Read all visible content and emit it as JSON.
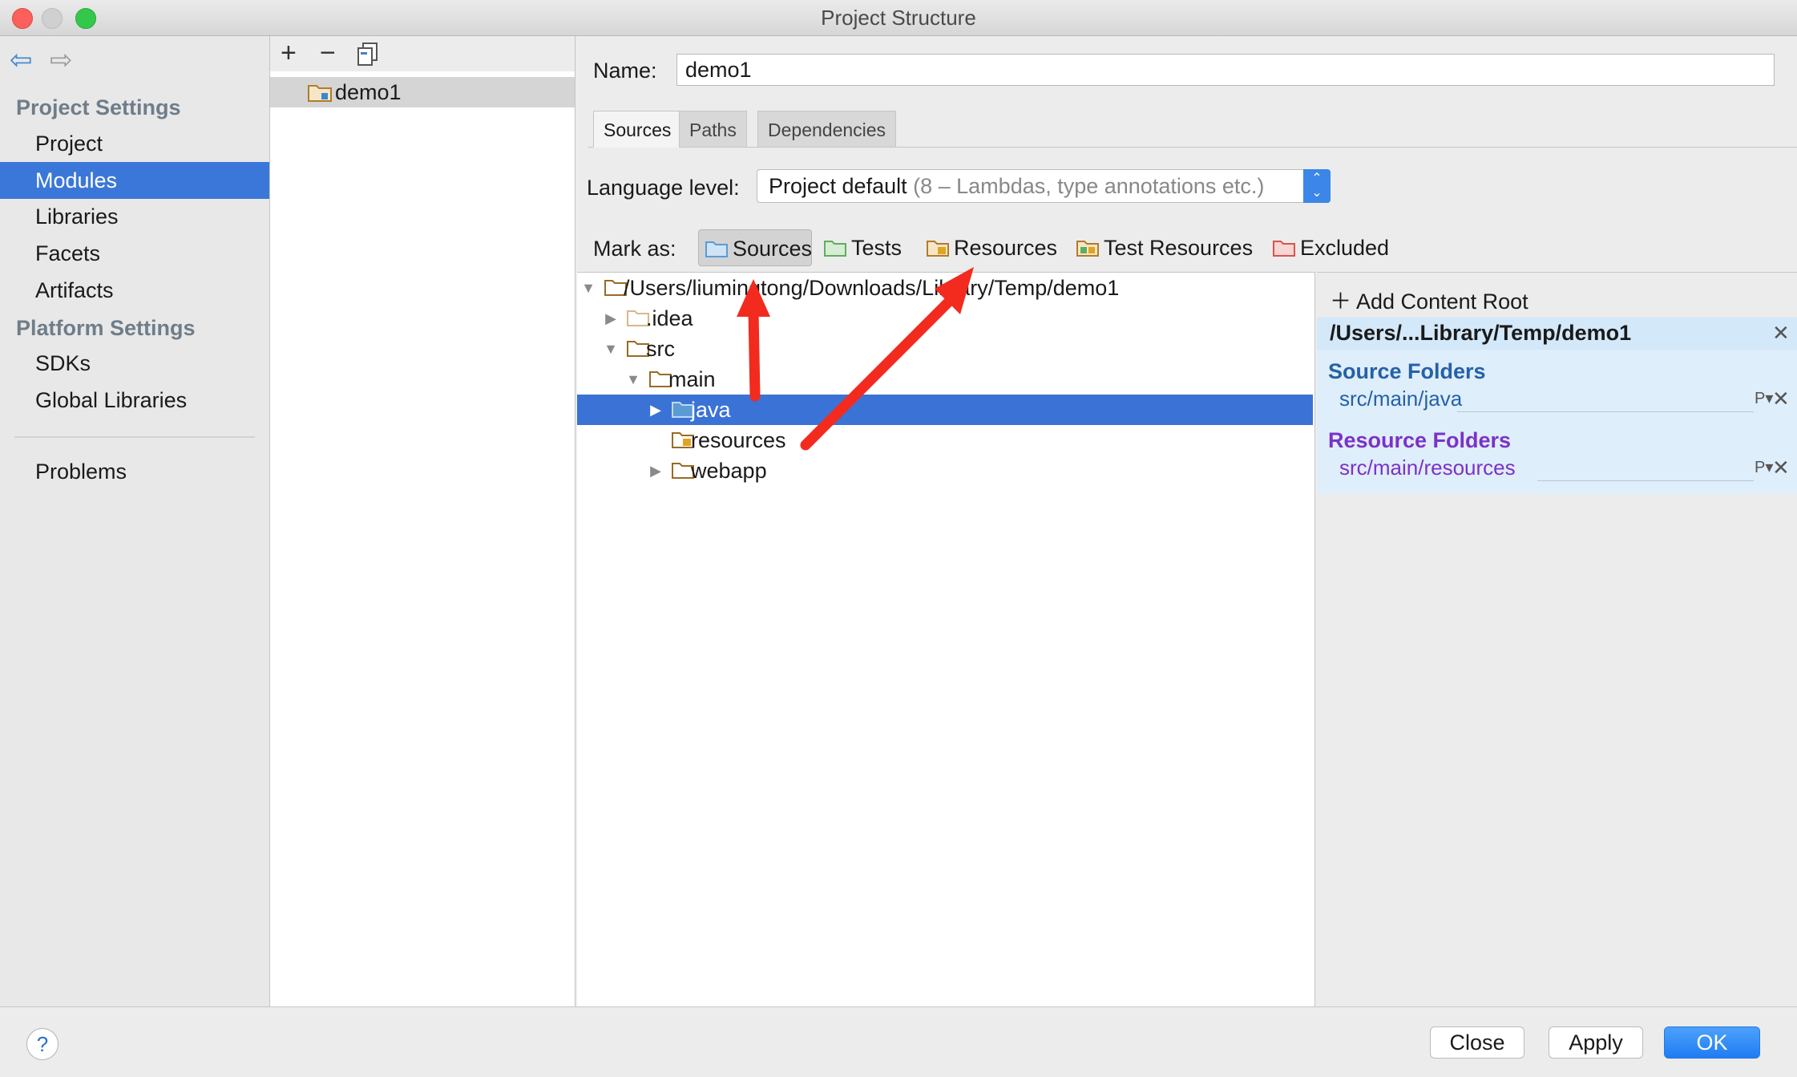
{
  "window": {
    "title": "Project Structure"
  },
  "sidebar": {
    "section_project": "Project Settings",
    "items_project": [
      "Project",
      "Modules",
      "Libraries",
      "Facets",
      "Artifacts"
    ],
    "section_platform": "Platform Settings",
    "items_platform": [
      "SDKs",
      "Global Libraries"
    ],
    "problems": "Problems",
    "selected": "Modules"
  },
  "modules": {
    "toolbar": {
      "add": "+",
      "remove": "−"
    },
    "items": [
      "demo1"
    ]
  },
  "content": {
    "name_label": "Name:",
    "name_value": "demo1",
    "tabs": [
      "Sources",
      "Paths",
      "Dependencies"
    ],
    "active_tab": "Sources",
    "language_label": "Language level:",
    "language_value": "Project default",
    "language_hint": "(8 – Lambdas, type annotations etc.)",
    "mark_as_label": "Mark as:",
    "mark_as": [
      {
        "label": "Sources",
        "color": "#5b9bd5"
      },
      {
        "label": "Tests",
        "color": "#5fae5f"
      },
      {
        "label": "Resources",
        "color": "#d9a441"
      },
      {
        "label": "Test Resources",
        "color": "#d9a441"
      },
      {
        "label": "Excluded",
        "color": "#d9534f"
      }
    ]
  },
  "tree": {
    "root": "/Users/liumingtong/Downloads/Library/Temp/demo1",
    "nodes": [
      ".idea",
      "src",
      "main",
      "java",
      "resources",
      "webapp"
    ],
    "selected": "java"
  },
  "content_root": {
    "add_label": "Add Content Root",
    "path": "/Users/...Library/Temp/demo1",
    "source_title": "Source Folders",
    "source_item": "src/main/java",
    "resource_title": "Resource Folders",
    "resource_item": "src/main/resources",
    "source_color": "#2461a8",
    "resource_color": "#7b32c8"
  },
  "footer": {
    "help": "?",
    "close": "Close",
    "apply": "Apply",
    "ok": "OK"
  },
  "colors": {
    "selection": "#3b77d8",
    "annotation_arrow": "#f22b1e"
  }
}
